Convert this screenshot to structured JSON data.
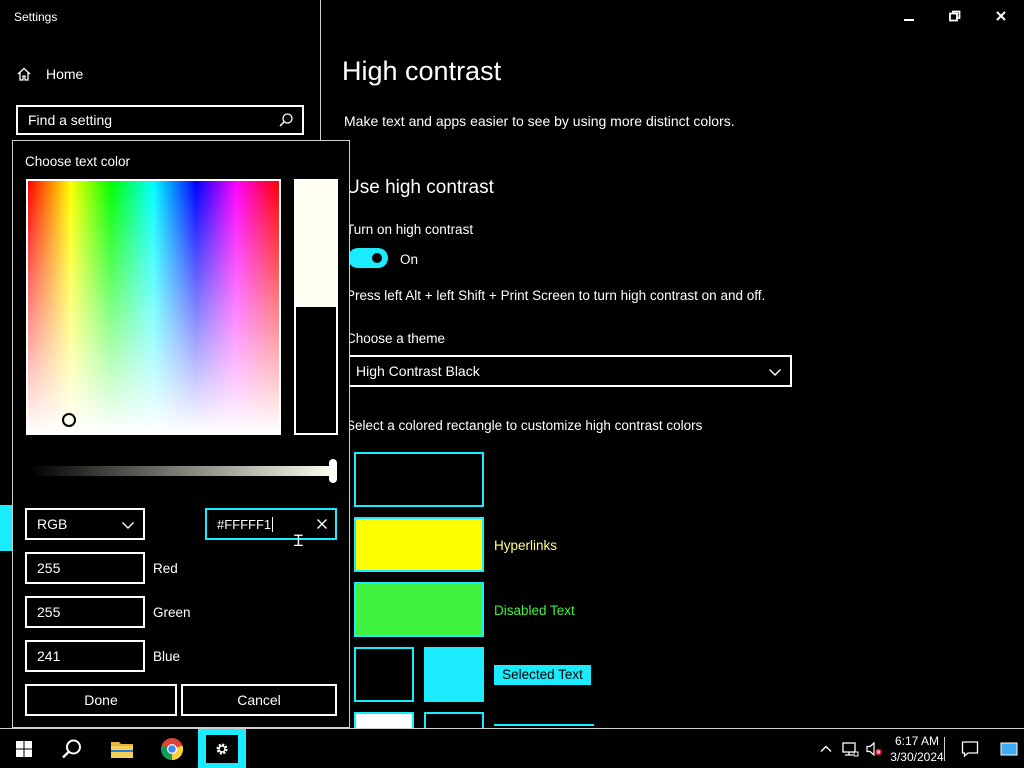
{
  "window": {
    "title": "Settings",
    "minimize": "–",
    "restore": "❐",
    "close": "✕"
  },
  "sidebar": {
    "home_label": "Home",
    "search_placeholder": "Find a setting"
  },
  "main": {
    "title": "High contrast",
    "description": "Make text and apps easier to see by using more distinct colors.",
    "section_heading": "Use high contrast",
    "toggle_label": "Turn on high contrast",
    "toggle_state": "On",
    "shortcut_text": "Press left Alt + left Shift + Print Screen to turn high contrast on and off.",
    "theme_label": "Choose a theme",
    "theme_value": "High Contrast Black",
    "rect_instruction": "Select a colored rectangle to customize high contrast colors",
    "swatches": [
      {
        "label": "",
        "color": "#000000"
      },
      {
        "label": "Hyperlinks",
        "color": "#ffff00",
        "text_color": "#ffff8a"
      },
      {
        "label": "Disabled Text",
        "color": "#3ff23f",
        "text_color": "#3ff23f"
      },
      {
        "label": "Selected Text",
        "color": "#1aebff",
        "text_color": "#000000"
      }
    ]
  },
  "picker": {
    "title": "Choose text color",
    "mode": "RGB",
    "hex_value": "#FFFFF1",
    "red_value": "255",
    "red_label": "Red",
    "green_value": "255",
    "green_label": "Green",
    "blue_value": "241",
    "blue_label": "Blue",
    "done_label": "Done",
    "cancel_label": "Cancel",
    "new_color": "#fffff1",
    "brightness_level": 1.0
  },
  "taskbar": {
    "time": "6:17 AM",
    "date": "3/30/2024"
  },
  "colors": {
    "accent": "#1aebff",
    "background": "#000000",
    "foreground": "#ffffff"
  }
}
